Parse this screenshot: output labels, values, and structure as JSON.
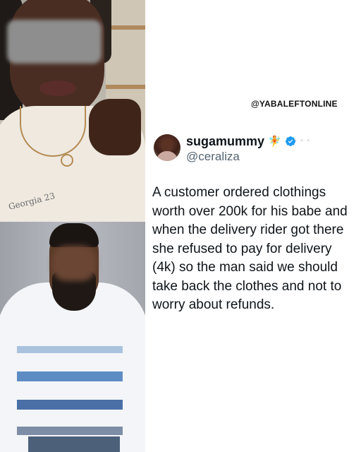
{
  "watermark": "@YABALEFTONLINE",
  "tweet": {
    "display_name": "sugamummy",
    "emoji": "🧚",
    "username": "@ceraliza",
    "text": "A customer ordered clothings worth over 200k for his babe and when the delivery rider got there she refused to pay for delivery (4k) so the man said we should take back the clothes and not to worry about refunds."
  },
  "photos": {
    "top_shirt_print": "Georgia 23"
  },
  "icons": {
    "verified": "verified-badge-icon",
    "avatar": "profile-avatar"
  },
  "colors": {
    "verified_blue": "#1d9bf0",
    "text_primary": "#0f1419",
    "text_secondary": "#536471"
  }
}
